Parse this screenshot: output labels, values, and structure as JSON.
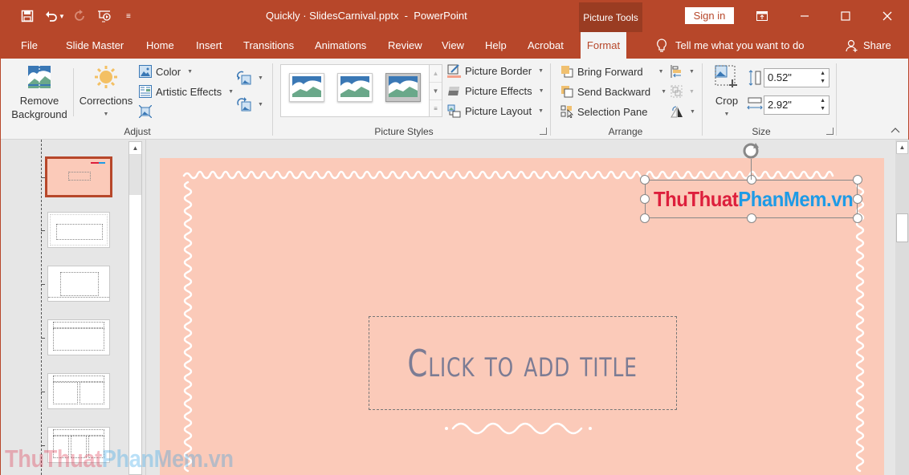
{
  "titlebar": {
    "document_title": "Quickly · SlidesCarnival.pptx  -  PowerPoint",
    "contextual_tab_group": "Picture Tools",
    "sign_in_label": "Sign in",
    "qat": [
      {
        "icon": "save-icon",
        "glyph": "💾"
      },
      {
        "icon": "undo-icon",
        "glyph": "↶"
      },
      {
        "icon": "redo-icon",
        "glyph": "↻"
      },
      {
        "icon": "start-from-beginning-icon",
        "glyph": "▶"
      },
      {
        "icon": "customize-qat-icon",
        "glyph": "≡"
      }
    ],
    "window_controls": {
      "ribbon_display": "▣",
      "minimize": "—",
      "maximize": "☐",
      "close": "✕"
    }
  },
  "menu_tabs": [
    {
      "label": "File"
    },
    {
      "label": "Slide Master"
    },
    {
      "label": "Home"
    },
    {
      "label": "Insert"
    },
    {
      "label": "Transitions"
    },
    {
      "label": "Animations"
    },
    {
      "label": "Review"
    },
    {
      "label": "View"
    },
    {
      "label": "Help"
    },
    {
      "label": "Acrobat"
    },
    {
      "label": "Format",
      "active": true
    }
  ],
  "tell_me": {
    "icon": "lightbulb-icon",
    "glyph": "💡",
    "label": "Tell me what you want to do"
  },
  "share": {
    "icon": "person-icon",
    "glyph": "👤",
    "label": "Share"
  },
  "ribbon": {
    "adjust": {
      "group_label": "Adjust",
      "remove_background_line1": "Remove",
      "remove_background_line2": "Background",
      "corrections_label": "Corrections",
      "color_label": "Color",
      "artistic_effects_label": "Artistic Effects"
    },
    "picture_styles": {
      "group_label": "Picture Styles",
      "picture_border_label": "Picture Border",
      "picture_effects_label": "Picture Effects",
      "picture_layout_label": "Picture Layout"
    },
    "arrange": {
      "group_label": "Arrange",
      "bring_forward_label": "Bring Forward",
      "send_backward_label": "Send Backward",
      "selection_pane_label": "Selection Pane"
    },
    "size": {
      "group_label": "Size",
      "crop_label": "Crop",
      "height_value": "0.52\"",
      "width_value": "2.92\""
    }
  },
  "slide": {
    "title_placeholder": "Click to add title",
    "logo": {
      "part1": "ThuThuat",
      "part2": "PhanMem",
      "part3": ".vn"
    }
  },
  "colors": {
    "accent": "#b7472a",
    "slide_bg": "#fbcab9",
    "logo_red": "#dd1f3c",
    "logo_blue": "#1e9be6",
    "title_text": "#7c7c94"
  },
  "watermark": {
    "part1": "ThuThuat",
    "part2": "PhanMem",
    "part3": ".vn"
  }
}
